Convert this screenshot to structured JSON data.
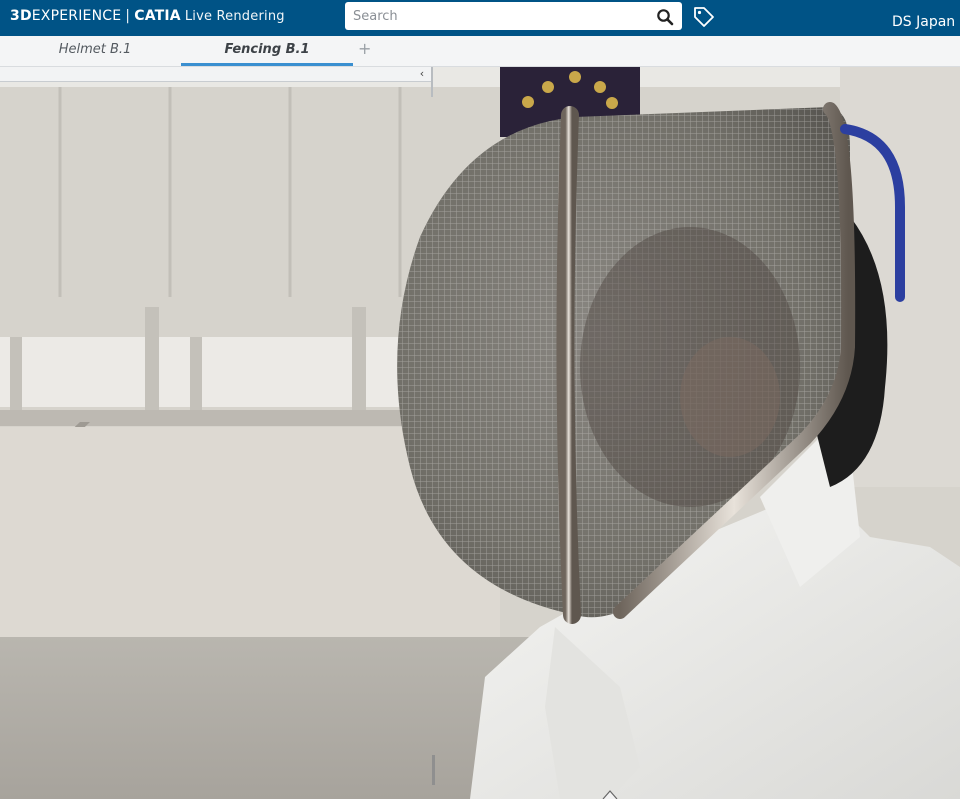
{
  "header": {
    "brand_3d": "3D",
    "brand_experience": "EXPERIENCE",
    "brand_separator": "|",
    "brand_app": "CATIA",
    "brand_module": "Live Rendering",
    "user_label": "DS Japan -"
  },
  "search": {
    "placeholder": "Search",
    "value": ""
  },
  "tabs": [
    {
      "label": "Helmet B.1",
      "active": false
    },
    {
      "label": "Fencing B.1",
      "active": true
    }
  ],
  "tab_add_label": "+",
  "icons": {
    "search": "search-icon",
    "tag": "tag-icon",
    "collapse": "chevron-left-icon",
    "bottom_handle": "chevron-up-icon"
  },
  "colors": {
    "topbar": "#005386",
    "active_tab_underline": "#3a8fd0",
    "helmet_trim": "#2c3fa0"
  },
  "panel": {
    "collapse_glyph": "‹"
  }
}
